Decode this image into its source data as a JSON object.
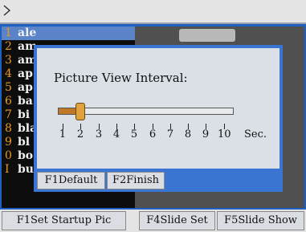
{
  "list": {
    "items": [
      {
        "num": "1",
        "label": "ale"
      },
      {
        "num": "2",
        "label": "am"
      },
      {
        "num": "3",
        "label": "am"
      },
      {
        "num": "4",
        "label": "ap"
      },
      {
        "num": "5",
        "label": "ap"
      },
      {
        "num": "6",
        "label": "ba"
      },
      {
        "num": "7",
        "label": "bi"
      },
      {
        "num": "8",
        "label": "bla"
      },
      {
        "num": "9",
        "label": "bl"
      },
      {
        "num": "0",
        "label": "bo"
      },
      {
        "num": "I",
        "label": "bushbuck"
      }
    ],
    "selected_index": 0
  },
  "dialog": {
    "title": "Picture View Interval:",
    "slider": {
      "min": 1,
      "max": 10,
      "value": 2,
      "ticks": [
        "1",
        "2",
        "3",
        "4",
        "5",
        "6",
        "7",
        "8",
        "9",
        "10"
      ],
      "unit": "Sec."
    },
    "buttons": {
      "default": "F1Default",
      "finish": "F2Finish"
    }
  },
  "toolbar": {
    "startup": "F1Set Startup Pic",
    "slide_set": "F4Slide Set",
    "slide_show": "F5Slide Show"
  },
  "colors": {
    "frame": "#1e60c2",
    "selection": "#5b83c8",
    "number": "#e89a20",
    "slider_thumb": "#e0a23c"
  }
}
